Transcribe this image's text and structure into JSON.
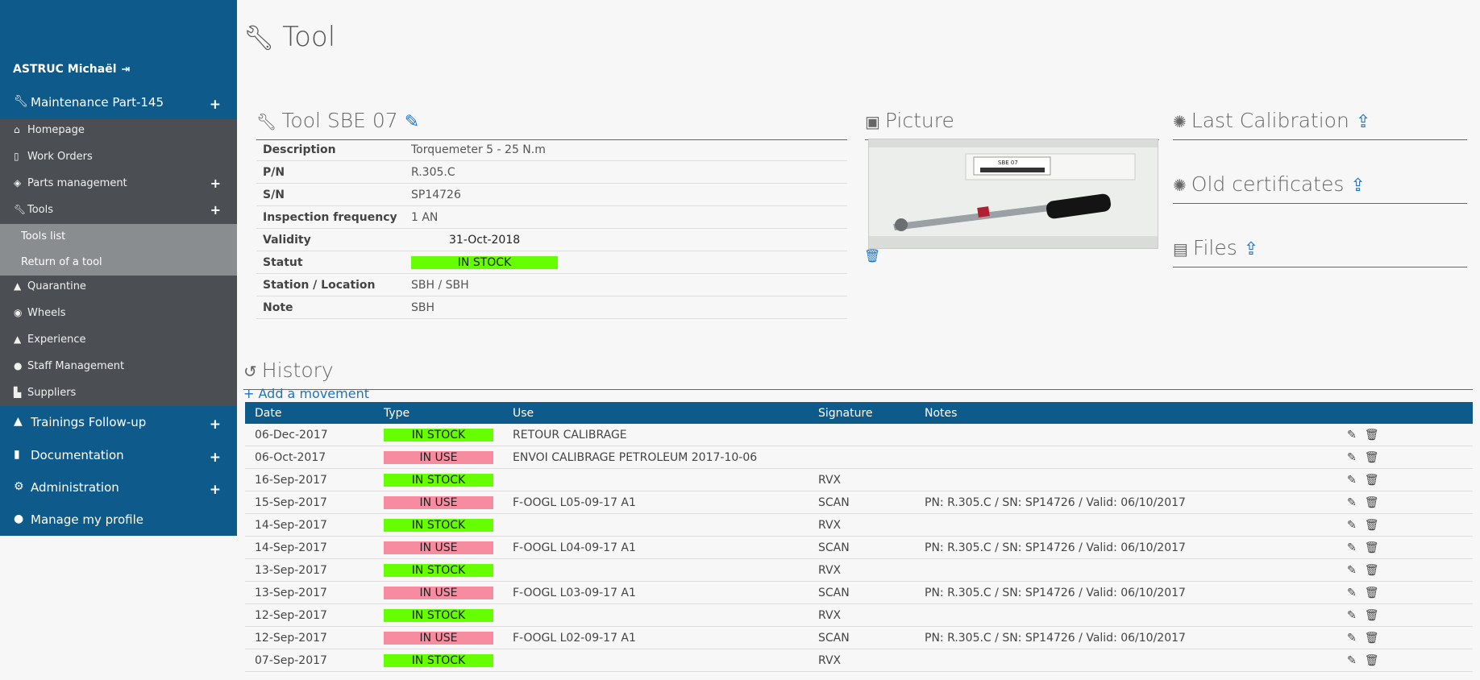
{
  "sidebar": {
    "user": "ASTRUC Michaël",
    "sections": {
      "maintenance": "Maintenance Part-145",
      "trainings": "Trainings Follow-up",
      "documentation": "Documentation",
      "administration": "Administration",
      "profile": "Manage my profile"
    },
    "items": [
      "Homepage",
      "Work Orders",
      "Parts management",
      "Tools",
      "Quarantine",
      "Wheels",
      "Experience",
      "Staff Management",
      "Suppliers"
    ],
    "tools_sub": [
      "Tools list",
      "Return of a tool"
    ]
  },
  "page": {
    "title": "Tool"
  },
  "tool": {
    "heading": "Tool SBE 07",
    "rows": [
      {
        "k": "Description",
        "v": "Torquemeter 5 - 25 N.m"
      },
      {
        "k": "P/N",
        "v": "R.305.C"
      },
      {
        "k": "S/N",
        "v": "SP14726"
      },
      {
        "k": "Inspection frequency",
        "v": "1 AN"
      },
      {
        "k": "Validity",
        "v": "31-Oct-2018"
      },
      {
        "k": "Statut",
        "v": "IN STOCK"
      },
      {
        "k": "Station / Location",
        "v": "SBH / SBH"
      },
      {
        "k": "Note",
        "v": "SBH"
      }
    ]
  },
  "panels": {
    "picture": "Picture",
    "last_calibration": "Last Calibration",
    "old_certificates": "Old certificates",
    "files": "Files",
    "picture_label": "SBE 07"
  },
  "history": {
    "title": "History",
    "add": "+ Add a movement",
    "columns": [
      "Date",
      "Type",
      "Use",
      "Signature",
      "Notes"
    ],
    "rows": [
      {
        "date": "06-Dec-2017",
        "type": "IN STOCK",
        "use": "RETOUR CALIBRAGE",
        "sig": "",
        "notes": ""
      },
      {
        "date": "06-Oct-2017",
        "type": "IN USE",
        "use": "ENVOI CALIBRAGE PETROLEUM 2017-10-06",
        "sig": "",
        "notes": ""
      },
      {
        "date": "16-Sep-2017",
        "type": "IN STOCK",
        "use": "",
        "sig": "RVX",
        "notes": ""
      },
      {
        "date": "15-Sep-2017",
        "type": "IN USE",
        "use": "F-OOGL L05-09-17 A1",
        "sig": "SCAN",
        "notes": "PN: R.305.C / SN: SP14726 / Valid: 06/10/2017"
      },
      {
        "date": "14-Sep-2017",
        "type": "IN STOCK",
        "use": "",
        "sig": "RVX",
        "notes": ""
      },
      {
        "date": "14-Sep-2017",
        "type": "IN USE",
        "use": "F-OOGL L04-09-17 A1",
        "sig": "SCAN",
        "notes": "PN: R.305.C / SN: SP14726 / Valid: 06/10/2017"
      },
      {
        "date": "13-Sep-2017",
        "type": "IN STOCK",
        "use": "",
        "sig": "RVX",
        "notes": ""
      },
      {
        "date": "13-Sep-2017",
        "type": "IN USE",
        "use": "F-OOGL L03-09-17 A1",
        "sig": "SCAN",
        "notes": "PN: R.305.C / SN: SP14726 / Valid: 06/10/2017"
      },
      {
        "date": "12-Sep-2017",
        "type": "IN STOCK",
        "use": "",
        "sig": "RVX",
        "notes": ""
      },
      {
        "date": "12-Sep-2017",
        "type": "IN USE",
        "use": "F-OOGL L02-09-17 A1",
        "sig": "SCAN",
        "notes": "PN: R.305.C / SN: SP14726 / Valid: 06/10/2017"
      },
      {
        "date": "07-Sep-2017",
        "type": "IN STOCK",
        "use": "",
        "sig": "RVX",
        "notes": ""
      }
    ]
  },
  "colors": {
    "sidebar": "#0e5a8a",
    "in_stock": "#66ff00",
    "in_use": "#f78ca0",
    "link": "#1e73be"
  }
}
